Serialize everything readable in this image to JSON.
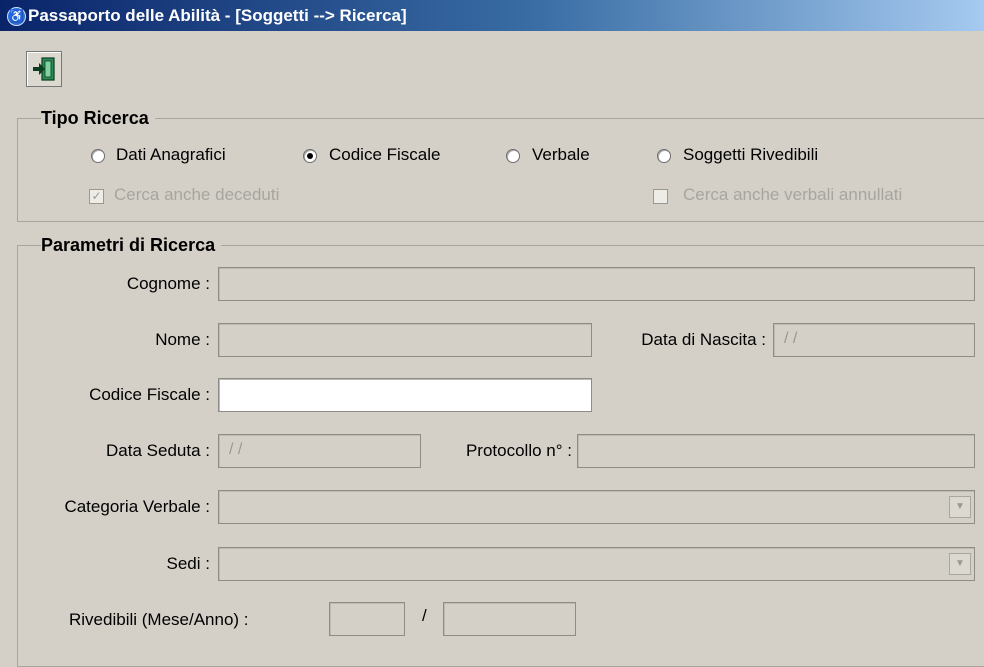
{
  "window": {
    "title": "Passaporto delle Abilità - [Soggetti --> Ricerca]",
    "app_icon": "wheelchair-icon"
  },
  "toolbar": {
    "exit_icon": "exit-door-icon"
  },
  "tipo_ricerca": {
    "legend": "Tipo Ricerca",
    "options": [
      {
        "label": "Dati Anagrafici",
        "checked": false
      },
      {
        "label": "Codice Fiscale",
        "checked": true
      },
      {
        "label": "Verbale",
        "checked": false
      },
      {
        "label": "Soggetti Rivedibili",
        "checked": false
      }
    ],
    "cerca_deceduti": {
      "label": "Cerca anche deceduti",
      "checked": true,
      "enabled": false
    },
    "cerca_annullati": {
      "label": "Cerca anche verbali annullati",
      "checked": false,
      "enabled": false
    }
  },
  "parametri": {
    "legend": "Parametri di Ricerca",
    "cognome": {
      "label": "Cognome :",
      "value": ""
    },
    "nome": {
      "label": "Nome :",
      "value": ""
    },
    "data_nascita": {
      "label": "Data di Nascita :",
      "value": "/ /"
    },
    "codice_fiscale": {
      "label": "Codice Fiscale :",
      "value": ""
    },
    "data_seduta": {
      "label": "Data Seduta :",
      "value": "/ /"
    },
    "protocollo": {
      "label": "Protocollo n° :",
      "value": ""
    },
    "categoria_verbale": {
      "label": "Categoria Verbale :",
      "value": ""
    },
    "sedi": {
      "label": "Sedi :",
      "value": ""
    },
    "rivedibili": {
      "label": "Rivedibili (Mese/Anno) :",
      "separator": "/",
      "mese": "",
      "anno": ""
    }
  }
}
